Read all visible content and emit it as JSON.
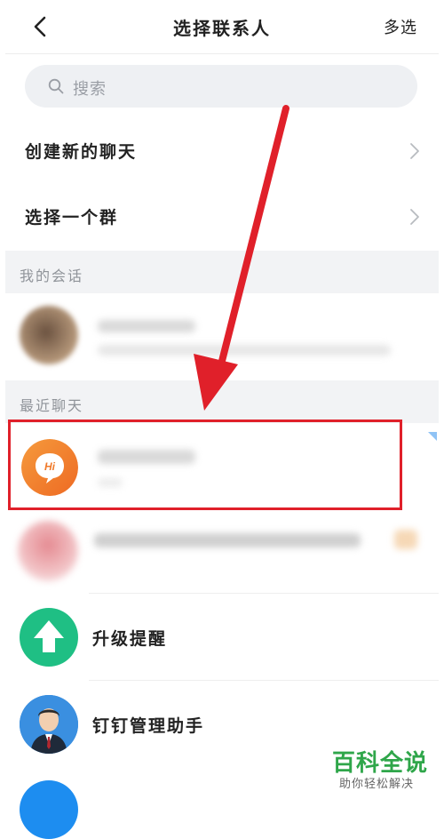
{
  "header": {
    "title": "选择联系人",
    "multi_select": "多选"
  },
  "search": {
    "placeholder": "搜索"
  },
  "menu": [
    {
      "label": "创建新的聊天"
    },
    {
      "label": "选择一个群"
    }
  ],
  "sections": {
    "my_conversations": "我的会话",
    "recent_chats": "最近聊天"
  },
  "contacts": [
    {
      "name": "升级提醒",
      "icon": "upload-arrow-icon",
      "color": "#1fbf84"
    },
    {
      "name": "钉钉管理助手",
      "icon": "assistant-avatar",
      "color": "#2a7fd6"
    }
  ],
  "highlighted_contact": {
    "avatar_text": "Hi",
    "avatar_color": "#f07a2a"
  },
  "watermark": {
    "title": "百科全说",
    "subtitle": "助你轻松解决"
  }
}
